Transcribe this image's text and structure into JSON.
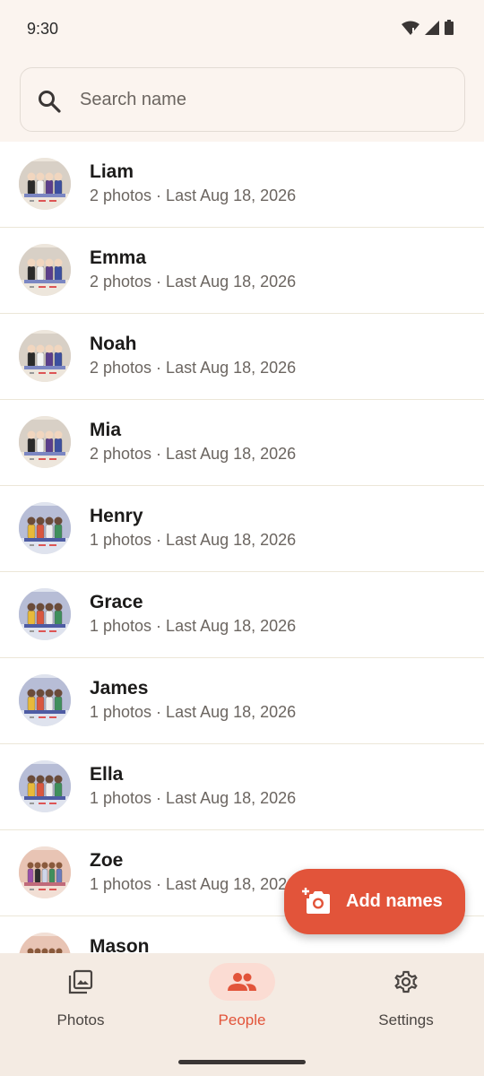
{
  "status": {
    "time": "9:30"
  },
  "search": {
    "placeholder": "Search name",
    "value": ""
  },
  "people": [
    {
      "name": "Liam",
      "meta": "2 photos · Last Aug 18, 2026",
      "thumb": "group-four-dark"
    },
    {
      "name": "Emma",
      "meta": "2 photos · Last Aug 18, 2026",
      "thumb": "group-four-dark"
    },
    {
      "name": "Noah",
      "meta": "2 photos · Last Aug 18, 2026",
      "thumb": "group-four-dark"
    },
    {
      "name": "Mia",
      "meta": "2 photos · Last Aug 18, 2026",
      "thumb": "group-four-dark"
    },
    {
      "name": "Henry",
      "meta": "1 photos · Last Aug 18, 2026",
      "thumb": "group-four-color"
    },
    {
      "name": "Grace",
      "meta": "1 photos · Last Aug 18, 2026",
      "thumb": "group-four-color"
    },
    {
      "name": "James",
      "meta": "1 photos · Last Aug 18, 2026",
      "thumb": "group-four-color"
    },
    {
      "name": "Ella",
      "meta": "1 photos · Last Aug 18, 2026",
      "thumb": "group-four-color"
    },
    {
      "name": "Zoe",
      "meta": "1 photos · Last Aug 18, 2026",
      "thumb": "group-five-color"
    },
    {
      "name": "Mason",
      "meta": "",
      "thumb": "group-five-color"
    }
  ],
  "fab": {
    "label": "Add names",
    "icon": "add-photo-camera-icon"
  },
  "nav": {
    "items": [
      {
        "label": "Photos",
        "icon": "photo-library-icon",
        "active": false
      },
      {
        "label": "People",
        "icon": "people-icon",
        "active": true
      },
      {
        "label": "Settings",
        "icon": "gear-icon",
        "active": false
      }
    ]
  },
  "colors": {
    "accent": "#e2543a",
    "background": "#fbf4ef",
    "nav_background": "#f4ebe3",
    "active_pill": "#fbdcd3"
  }
}
